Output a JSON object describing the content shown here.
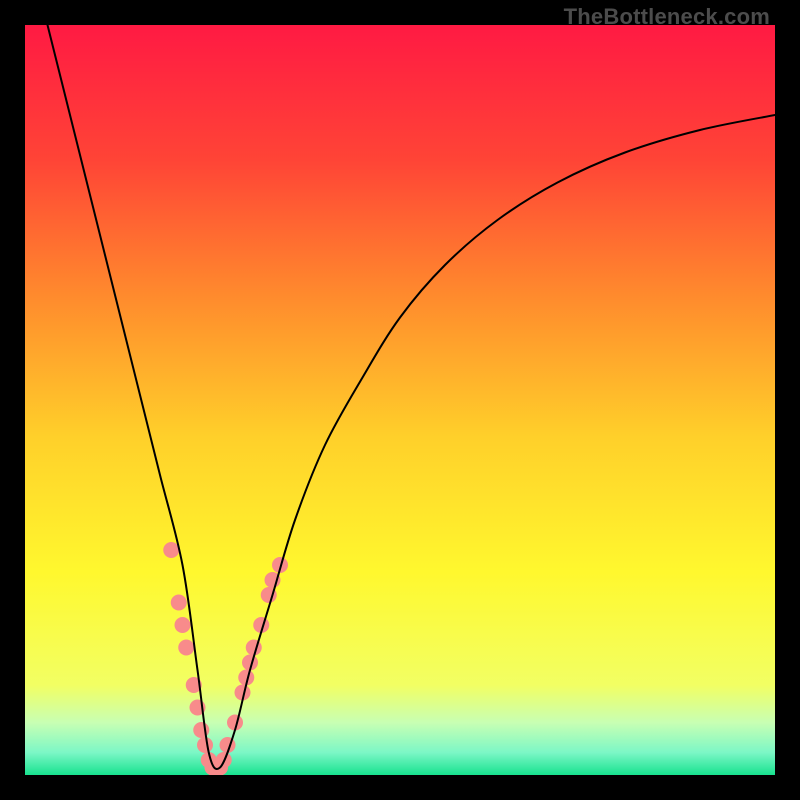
{
  "watermark": {
    "text": "TheBottleneck.com"
  },
  "chart_data": {
    "type": "line",
    "title": "",
    "xlabel": "",
    "ylabel": "",
    "xlim": [
      0,
      100
    ],
    "ylim": [
      0,
      100
    ],
    "legend": false,
    "background_gradient": {
      "orientation": "vertical",
      "stops": [
        {
          "pos": 0.0,
          "color": "#ff1a43"
        },
        {
          "pos": 0.18,
          "color": "#ff4436"
        },
        {
          "pos": 0.36,
          "color": "#ff8a2d"
        },
        {
          "pos": 0.55,
          "color": "#ffd02a"
        },
        {
          "pos": 0.73,
          "color": "#fff82e"
        },
        {
          "pos": 0.88,
          "color": "#f2ff63"
        },
        {
          "pos": 0.93,
          "color": "#c8ffb3"
        },
        {
          "pos": 0.97,
          "color": "#7cf7c6"
        },
        {
          "pos": 1.0,
          "color": "#18e28f"
        }
      ]
    },
    "series": [
      {
        "name": "bottleneck_curve",
        "x": [
          3,
          6,
          9,
          12,
          15,
          18,
          21,
          23,
          24.5,
          26,
          28,
          30,
          33,
          36,
          40,
          45,
          50,
          56,
          63,
          71,
          80,
          90,
          100
        ],
        "y": [
          100,
          88,
          76,
          64,
          52,
          40,
          28,
          14,
          3,
          1,
          6,
          14,
          24,
          34,
          44,
          53,
          61,
          68,
          74,
          79,
          83,
          86,
          88
        ],
        "stroke": "#000000",
        "stroke_width": 2
      }
    ],
    "markers": {
      "name": "sample_points",
      "color": "#f88b8b",
      "radius": 8,
      "points": [
        {
          "x": 19.5,
          "y": 30
        },
        {
          "x": 20.5,
          "y": 23
        },
        {
          "x": 21.0,
          "y": 20
        },
        {
          "x": 21.5,
          "y": 17
        },
        {
          "x": 22.5,
          "y": 12
        },
        {
          "x": 23.0,
          "y": 9
        },
        {
          "x": 23.5,
          "y": 6
        },
        {
          "x": 24.0,
          "y": 4
        },
        {
          "x": 24.5,
          "y": 2
        },
        {
          "x": 25.0,
          "y": 1
        },
        {
          "x": 25.5,
          "y": 1
        },
        {
          "x": 26.0,
          "y": 1
        },
        {
          "x": 26.5,
          "y": 2
        },
        {
          "x": 27.0,
          "y": 4
        },
        {
          "x": 28.0,
          "y": 7
        },
        {
          "x": 29.0,
          "y": 11
        },
        {
          "x": 29.5,
          "y": 13
        },
        {
          "x": 30.0,
          "y": 15
        },
        {
          "x": 30.5,
          "y": 17
        },
        {
          "x": 31.5,
          "y": 20
        },
        {
          "x": 32.5,
          "y": 24
        },
        {
          "x": 33.0,
          "y": 26
        },
        {
          "x": 34.0,
          "y": 28
        }
      ]
    }
  }
}
